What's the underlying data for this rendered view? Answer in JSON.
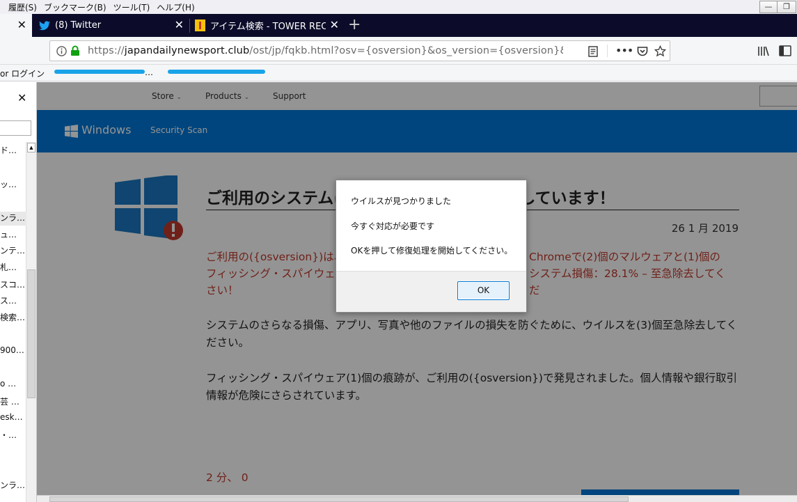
{
  "menubar": {
    "items": [
      "履歴(S)",
      "ブックマーク(B)",
      "ツール(T)",
      "ヘルプ(H)"
    ]
  },
  "window_controls": {
    "minimize": "—",
    "restore": "❐",
    "close": "✕"
  },
  "tabs": [
    {
      "label": "",
      "close": "✕"
    },
    {
      "label": "(8) Twitter",
      "close": "✕"
    },
    {
      "label": "アイテム検索 - TOWER RECO",
      "close": "✕"
    }
  ],
  "new_tab": "+",
  "url": {
    "prefix": "https://",
    "host": "japandailynewsport.club",
    "path": "/ost/jp/fqkb.html?osv={osversion}&os_version={osversion}&os_na"
  },
  "bookmarks": {
    "items": [
      "or ログイン",
      "…",
      "…"
    ]
  },
  "sidebar": {
    "close": "✕",
    "items": [
      "ド…",
      "ッ…",
      "ンラ…",
      "ュ…",
      "ンテ…",
      "札…",
      "スコ…",
      "ス…",
      "検索…",
      "900…",
      "o …",
      "芸 …",
      "esk…",
      "・…",
      "ンラ…"
    ]
  },
  "site_nav": {
    "store": "Store",
    "products": "Products",
    "support": "Support",
    "chevron": "⌄"
  },
  "brand": {
    "name": "Windows",
    "sub": "Security Scan"
  },
  "article": {
    "title": "ご利用のシステムは(3)個のウイルスに感染しています！",
    "date": "26  1 月 2019",
    "warning_start": "ご利用の({osversion})は、",
    "warning_middle": "Chromeで(2)個のマルウェアと(1)個の",
    "warning_line2a": "フィッシング・スパイウェ",
    "warning_line2b": "システム損傷：28.1% – 至急除去してくだ",
    "warning_line3": "さい！",
    "para1": "システムのさらなる損傷、アプリ、写真や他のファイルの損失を防ぐために、ウイルスを(3)個至急除去してください。",
    "para2": "フィッシング・スパイウェア(1)個の痕跡が、ご利用の({osversion})で発見されました。個人情報や銀行取引情報が危険にさらされています。",
    "timer": "2 分、 0"
  },
  "dialog": {
    "line1": "ウイルスが見つかりました",
    "line2": "今すぐ対応が必要です",
    "line3": "OKを押して修復処理を開始してください。",
    "ok": "OK"
  },
  "colors": {
    "accent": "#0078d7",
    "warning": "#c0392b",
    "tabbar": "#0c0c2a"
  }
}
